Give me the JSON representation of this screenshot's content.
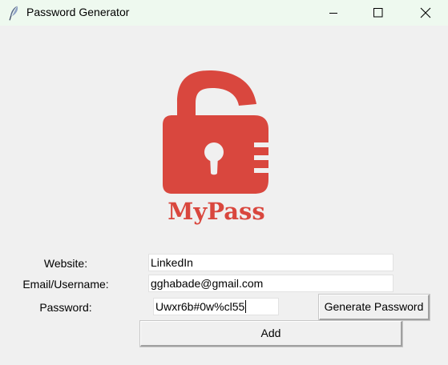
{
  "window": {
    "title": "Password Generator",
    "titlebar_color": "#eef9ef",
    "icon": "feather-icon",
    "controls": [
      "minimize-icon",
      "maximize-icon",
      "close-icon"
    ]
  },
  "logo": {
    "icon": "padlock-icon",
    "text": "MyPass",
    "color": "#d9473e"
  },
  "form": {
    "website_label": "Website:",
    "website_value": "LinkedIn",
    "email_label": "Email/Username:",
    "email_value": "gghabade@gmail.com",
    "password_label": "Password:",
    "password_value": "Uwxr6b#0w%cl55",
    "generate_label": "Generate Password",
    "add_label": "Add"
  }
}
